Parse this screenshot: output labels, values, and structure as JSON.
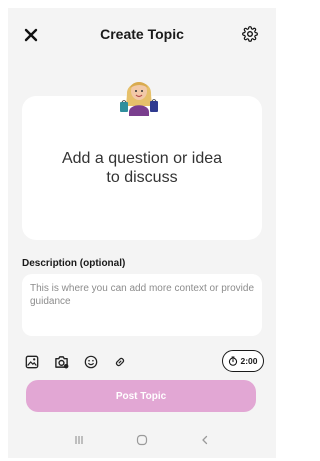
{
  "header": {
    "title": "Create Topic",
    "close_icon": "close-icon",
    "settings_icon": "gear-icon"
  },
  "prompt": {
    "text": "Add a question or idea\nto discuss"
  },
  "description": {
    "label": "Description (optional)",
    "placeholder": "This is where you can add more context or provide guidance",
    "value": ""
  },
  "toolbar": {
    "icons": [
      "image-icon",
      "camera-icon",
      "emoji-icon",
      "link-icon"
    ],
    "timer": "2:00",
    "timer_icon": "stopwatch-icon"
  },
  "actions": {
    "post_label": "Post Topic"
  },
  "navbar": {
    "icons": [
      "recent-apps-icon",
      "home-icon",
      "back-icon"
    ]
  },
  "colors": {
    "accent": "#e2a7d4",
    "background": "#f4f4f4",
    "card": "#ffffff"
  }
}
